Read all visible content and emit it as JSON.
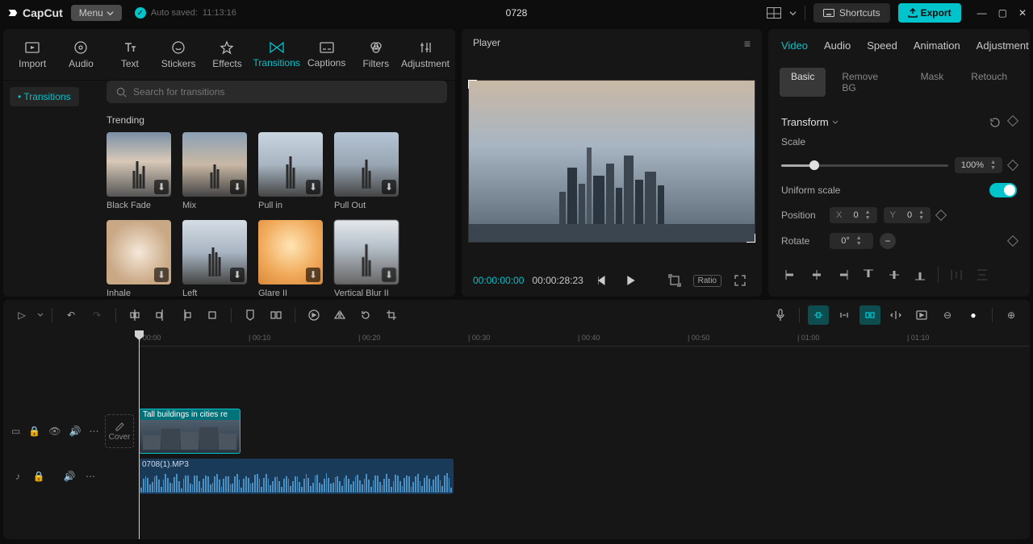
{
  "titlebar": {
    "app_name": "CapCut",
    "menu_label": "Menu",
    "autosave_label": "Auto saved:",
    "autosave_time": "11:13:16",
    "project_name": "0728",
    "shortcuts_label": "Shortcuts",
    "export_label": "Export"
  },
  "media_tabs": [
    {
      "label": "Import"
    },
    {
      "label": "Audio"
    },
    {
      "label": "Text"
    },
    {
      "label": "Stickers"
    },
    {
      "label": "Effects"
    },
    {
      "label": "Transitions"
    },
    {
      "label": "Captions"
    },
    {
      "label": "Filters"
    },
    {
      "label": "Adjustment"
    }
  ],
  "media_side": {
    "transitions": "Transitions"
  },
  "search_placeholder": "Search for transitions",
  "trending_label": "Trending",
  "thumbs": [
    {
      "label": "Black Fade"
    },
    {
      "label": "Mix"
    },
    {
      "label": "Pull in"
    },
    {
      "label": "Pull Out"
    },
    {
      "label": "Inhale"
    },
    {
      "label": "Left"
    },
    {
      "label": "Glare II"
    },
    {
      "label": "Vertical Blur II"
    }
  ],
  "player": {
    "title": "Player",
    "time_current": "00:00:00:00",
    "time_total": "00:00:28:23",
    "ratio_label": "Ratio"
  },
  "props_tabs": [
    {
      "label": "Video"
    },
    {
      "label": "Audio"
    },
    {
      "label": "Speed"
    },
    {
      "label": "Animation"
    },
    {
      "label": "Adjustment"
    }
  ],
  "sub_tabs": [
    {
      "label": "Basic"
    },
    {
      "label": "Remove BG"
    },
    {
      "label": "Mask"
    },
    {
      "label": "Retouch"
    }
  ],
  "transform": {
    "title": "Transform",
    "scale_label": "Scale",
    "scale_value": "100%",
    "uniform_label": "Uniform scale",
    "position_label": "Position",
    "x_label": "X",
    "x_value": "0",
    "y_label": "Y",
    "y_value": "0",
    "rotate_label": "Rotate",
    "rotate_value": "0°"
  },
  "ruler": [
    "00:00",
    "00:10",
    "00:20",
    "00:30",
    "00:40",
    "00:50",
    "01:00",
    "01:10"
  ],
  "cover_label": "Cover",
  "clip_label": "Tall buildings in cities re",
  "audio_clip_label": "0708(1).MP3"
}
